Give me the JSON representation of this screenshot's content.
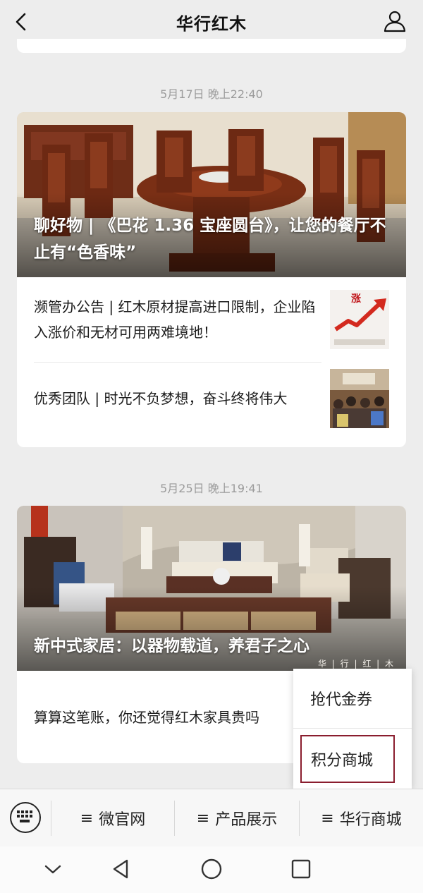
{
  "header": {
    "title": "华行红木",
    "back_icon": "back-chevron-icon",
    "profile_icon": "user-profile-icon"
  },
  "timestamps": [
    "5月17日 晚上22:40",
    "5月25日 晚上19:41"
  ],
  "card1": {
    "hero_title": "聊好物 | 《巴花 1.36 宝座圆台》，让您的餐厅不止有“色香味”",
    "items": [
      {
        "text": "濒管办公告 | 红木原材提高进口限制，企业陷入涨价和无材可用两难境地！",
        "thumb_text": "涨"
      },
      {
        "text": "优秀团队 | 时光不负梦想，奋斗终将伟大"
      }
    ]
  },
  "card2": {
    "hero_title": "新中式家居：以器物载道，养君子之心",
    "watermark": "华 | 行 | 红 | 木",
    "items": [
      {
        "text": "算算这笔账，你还觉得红木家具贵吗"
      }
    ]
  },
  "popup_menu": {
    "items": [
      "抢代金券",
      "积分商城"
    ],
    "selected": "积分商城"
  },
  "menu_bar": {
    "keyboard_icon": "keyboard-icon",
    "tabs": [
      {
        "glyph": "≡",
        "label": "微官网"
      },
      {
        "glyph": "≡",
        "label": "产品展示"
      },
      {
        "glyph": "≡",
        "label": "华行商城"
      }
    ]
  },
  "system_nav": [
    "collapse-chevron-icon",
    "back-triangle-icon",
    "home-circle-icon",
    "recents-square-icon"
  ],
  "colors": {
    "background": "#ededed",
    "card": "#ffffff",
    "accent_border": "#8a1d2e",
    "timestamp": "#9b9b9b"
  }
}
